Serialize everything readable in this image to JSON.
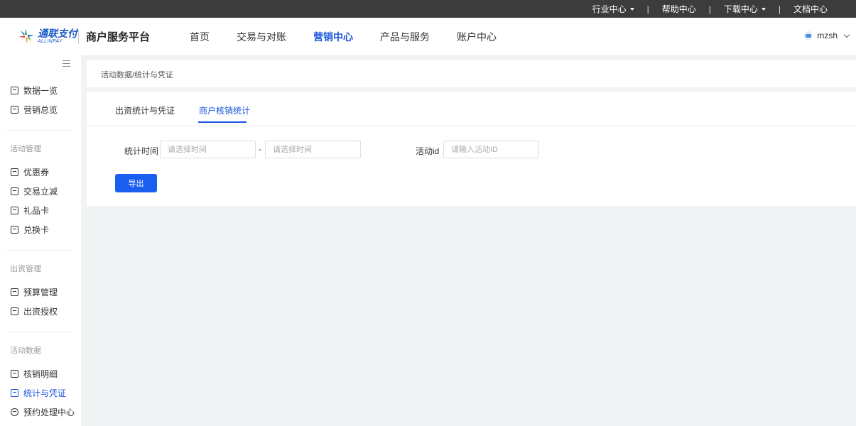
{
  "topbar": {
    "items": [
      {
        "label": "行业中心",
        "has_dropdown": true
      },
      {
        "label": "帮助中心",
        "has_dropdown": false
      },
      {
        "label": "下载中心",
        "has_dropdown": true
      },
      {
        "label": "文档中心",
        "has_dropdown": false
      }
    ],
    "separator": "|"
  },
  "header": {
    "logo_cn": "通联支付",
    "logo_en": "ALLINPAY",
    "platform_title": "商户服务平台",
    "nav": [
      {
        "label": "首页",
        "active": false
      },
      {
        "label": "交易与对账",
        "active": false
      },
      {
        "label": "营销中心",
        "active": true
      },
      {
        "label": "产品与服务",
        "active": false
      },
      {
        "label": "账户中心",
        "active": false
      }
    ],
    "username": "mzsh"
  },
  "sidebar": {
    "top_items": [
      {
        "label": "数据一览",
        "icon": "chart-icon"
      },
      {
        "label": "营销总览",
        "icon": "chart-icon"
      }
    ],
    "groups": [
      {
        "title": "活动管理",
        "items": [
          {
            "label": "优惠券",
            "icon": "coupon-icon"
          },
          {
            "label": "交易立减",
            "icon": "discount-icon"
          },
          {
            "label": "礼品卡",
            "icon": "gift-card-icon"
          },
          {
            "label": "兑换卡",
            "icon": "exchange-card-icon"
          }
        ]
      },
      {
        "title": "出资管理",
        "items": [
          {
            "label": "预算管理",
            "icon": "budget-icon"
          },
          {
            "label": "出资授权",
            "icon": "authorization-icon"
          }
        ]
      },
      {
        "title": "活动数据",
        "items": [
          {
            "label": "核销明细",
            "icon": "detail-icon"
          },
          {
            "label": "统计与凭证",
            "icon": "statistics-icon",
            "active": true
          },
          {
            "label": "预约处理中心",
            "icon": "reservation-icon"
          }
        ]
      }
    ]
  },
  "breadcrumb": "活动数据/统计与凭证",
  "tabs": [
    {
      "label": "出资统计与凭证",
      "active": false
    },
    {
      "label": "商户核销统计",
      "active": true
    }
  ],
  "form": {
    "time_label": "统计时间",
    "start_placeholder": "请选择时间",
    "range_separator": "-",
    "end_placeholder": "请选择时间",
    "activity_label": "活动id",
    "activity_placeholder": "请输入活动ID",
    "export_label": "导出"
  },
  "colors": {
    "accent": "#1a56db",
    "button": "#1a5ef0",
    "topbar": "#3c3c3c"
  }
}
